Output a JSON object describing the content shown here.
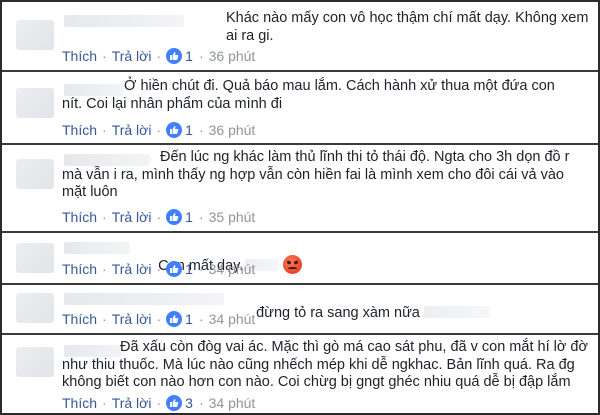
{
  "labels": {
    "like": "Thích",
    "reply": "Trả lời",
    "dot": "·"
  },
  "colors": {
    "link": "#365899",
    "meta": "#90949c",
    "like_badge": "#4080ff",
    "text": "#1d2129",
    "angry_emoji": "#e8442a"
  },
  "comments": [
    {
      "text": "Khác nào mấy con vô học thậm chí mất dạy. Không xem\nai ra gi.",
      "likes": "1",
      "time": "36 phút"
    },
    {
      "text": "Ở hiền chút đi. Quả báo mau lắm. Cách hành xử thua một đứa con\nnít. Coi lại nhân phẩm của mình đi",
      "likes": "1",
      "time": "36 phút"
    },
    {
      "text": "Đến lúc ng khác làm thủ lĩnh thi tỏ thái độ. Ngta cho 3h dọn đồ r\nmà vẫn i ra, mình thấy ng hợp vẫn còn hiền fai là mình xem cho đôi cái vả vào\nmặt luôn",
      "likes": "1",
      "time": "35 phút"
    },
    {
      "text": "Con mất dạy.",
      "emoji": "angry-emoji",
      "likes": "1",
      "time": "34 phút"
    },
    {
      "text": "đừng tỏ ra sang xàm nữa",
      "likes": "1",
      "time": "34 phút"
    },
    {
      "text": "Đã xấu còn đòg vai ác. Mặc thì gò má cao sát phu, đã v con mắt hí lờ đờ\nnhư thiu thuốc. Mà lúc nào cũng nhếch mép khi dễ ngkhac. Bản lĩnh quá. Ra đg\nkhông biết con nào hơn con nào. Coi chừg bị gngt ghéc nhiu quá dễ bị đập lắm",
      "likes": "3",
      "time": "34 phút"
    }
  ]
}
